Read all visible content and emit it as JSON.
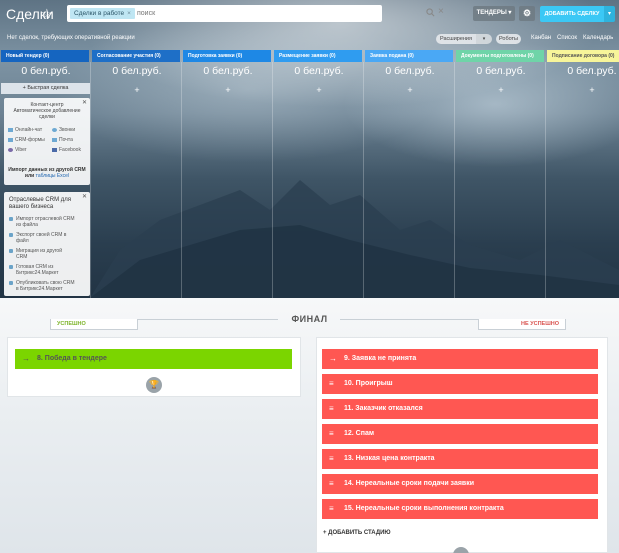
{
  "header": {
    "title": "Сделки",
    "filter_chip": "Сделки в работе",
    "search_placeholder": "поиск",
    "tenders_label": "ТЕНДЕРЫ",
    "add_deal_label": "ДОБАВИТЬ СДЕЛКУ"
  },
  "toolbar": {
    "notice": "Нет сделок, требующих оперативной реакции",
    "extensions_label": "Расширения",
    "robots_label": "Роботы",
    "views": [
      "Канбан",
      "Список",
      "Календарь"
    ]
  },
  "stages": [
    {
      "label": "Новый тендер (0)",
      "color": "#1565c0",
      "sum": "0 бел.руб."
    },
    {
      "label": "Согласование участия (0)",
      "color": "#1e6fc7",
      "sum": "0 бел.руб."
    },
    {
      "label": "Подготовка заявки (0)",
      "color": "#1e88e5",
      "sum": "0 бел.руб."
    },
    {
      "label": "Размещение заявки (0)",
      "color": "#2f9cf0",
      "sum": "0 бел.руб."
    },
    {
      "label": "Заявка подана (0)",
      "color": "#4aa8f5",
      "sum": "0 бел.руб."
    },
    {
      "label": "Документы подготовлены (0)",
      "color": "#6fd4a8",
      "sum": "0 бел.руб."
    },
    {
      "label": "Подписание договора (0)",
      "color": "#f7f59a",
      "sum": "0 бел.руб."
    }
  ],
  "quick_deal_label": "+ Быстрая сделка",
  "contact_center": {
    "title_line1": "Контакт-центр",
    "title_line2": "Автоматическое добавление",
    "title_line3": "сделки",
    "items": [
      "Онлайн-чат",
      "Звонки",
      "CRM-формы",
      "Почта",
      "Viber",
      "Facebook"
    ],
    "import_line1": "Импорт данных из другой CRM",
    "import_line2_pre": "или",
    "import_line2_link": "таблицы Excel"
  },
  "industry": {
    "title_line1": "Отраслевые CRM для",
    "title_line2": "вашего бизнеса",
    "items": [
      [
        "Импорт отраслевой CRM",
        "из файла"
      ],
      [
        "Экспорт своей CRM в",
        "файл"
      ],
      [
        "Миграция из другой",
        "CRM"
      ],
      [
        "Готовая CRM из",
        "Битрикс24.Маркет"
      ],
      [
        "Опубликовать свою CRM",
        "в Битрикс24.Маркет"
      ]
    ]
  },
  "final": {
    "title": "ФИНАЛ",
    "success_tab": "УСПЕШНО",
    "fail_tab": "НЕ УСПЕШНО",
    "success_stage": "8. Победа в тендере",
    "fail_stages": [
      "9. Заявка не принята",
      "10. Проигрыш",
      "11. Заказчик отказался",
      "12. Спам",
      "13. Низкая цена контракта",
      "14. Нереальные сроки подачи заявки",
      "15. Нереальные сроки выполнения контракта"
    ],
    "add_stage_label": "+ ДОБАВИТЬ СТАДИЮ"
  },
  "colors": {
    "success_green": "#7bd500",
    "fail_red": "#ff5752",
    "accent_blue": "#3bc8f5"
  }
}
